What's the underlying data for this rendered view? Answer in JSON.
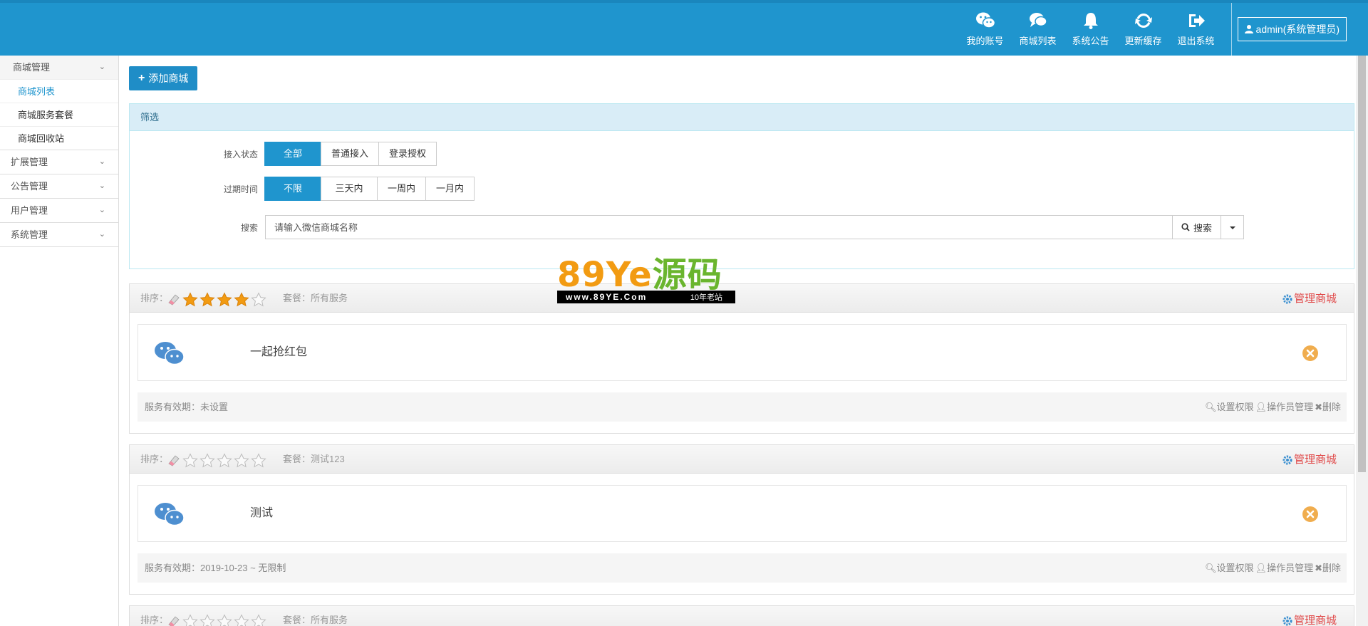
{
  "topnav": {
    "items": [
      {
        "label": "我的账号",
        "icon": "wechat-icon"
      },
      {
        "label": "商城列表",
        "icon": "comments-icon"
      },
      {
        "label": "系统公告",
        "icon": "bell-icon"
      },
      {
        "label": "更新缓存",
        "icon": "refresh-icon"
      },
      {
        "label": "退出系统",
        "icon": "sign-out-icon"
      }
    ],
    "admin_label": "admin(系统管理员)"
  },
  "sidebar": {
    "groups": [
      {
        "label": "商城管理",
        "items": [
          "商城列表",
          "商城服务套餐",
          "商城回收站"
        ]
      },
      {
        "label": "扩展管理"
      },
      {
        "label": "公告管理"
      },
      {
        "label": "用户管理"
      },
      {
        "label": "系统管理"
      }
    ],
    "active_item": "商城列表"
  },
  "add_button_label": "添加商城",
  "filter": {
    "title": "筛选",
    "access_label": "接入状态",
    "access_options": [
      "全部",
      "普通接入",
      "登录授权"
    ],
    "expire_label": "过期时间",
    "expire_options": [
      "不限",
      "三天内",
      "一周内",
      "一月内"
    ],
    "search_label": "搜索",
    "search_placeholder": "请输入微信商城名称",
    "search_button": "搜索"
  },
  "watermark": {
    "logo_a": "89Ye",
    "logo_b": "源码",
    "url": "www.89YE.Com",
    "tag": "10年老站"
  },
  "shops": [
    {
      "sort_label": "排序：",
      "stars": 4,
      "package": "套餐：所有服务",
      "manage": "管理商城",
      "name": "一起抢红包",
      "validity": "服务有效期：未设置",
      "actions": [
        "设置权限",
        "操作员管理",
        "删除"
      ]
    },
    {
      "sort_label": "排序：",
      "stars": 0,
      "package": "套餐：测试123",
      "manage": "管理商城",
      "name": "测试",
      "validity": "服务有效期：2019-10-23 ~ 无限制",
      "actions": [
        "设置权限",
        "操作员管理",
        "删除"
      ]
    },
    {
      "sort_label": "排序：",
      "stars": 0,
      "package": "套餐：所有服务",
      "manage": "管理商城",
      "name": "",
      "validity": "",
      "actions": []
    }
  ],
  "colors": {
    "primary": "#1f95ce",
    "danger": "#e04848",
    "star": "#f29b12",
    "close": "#f0ad4e"
  }
}
